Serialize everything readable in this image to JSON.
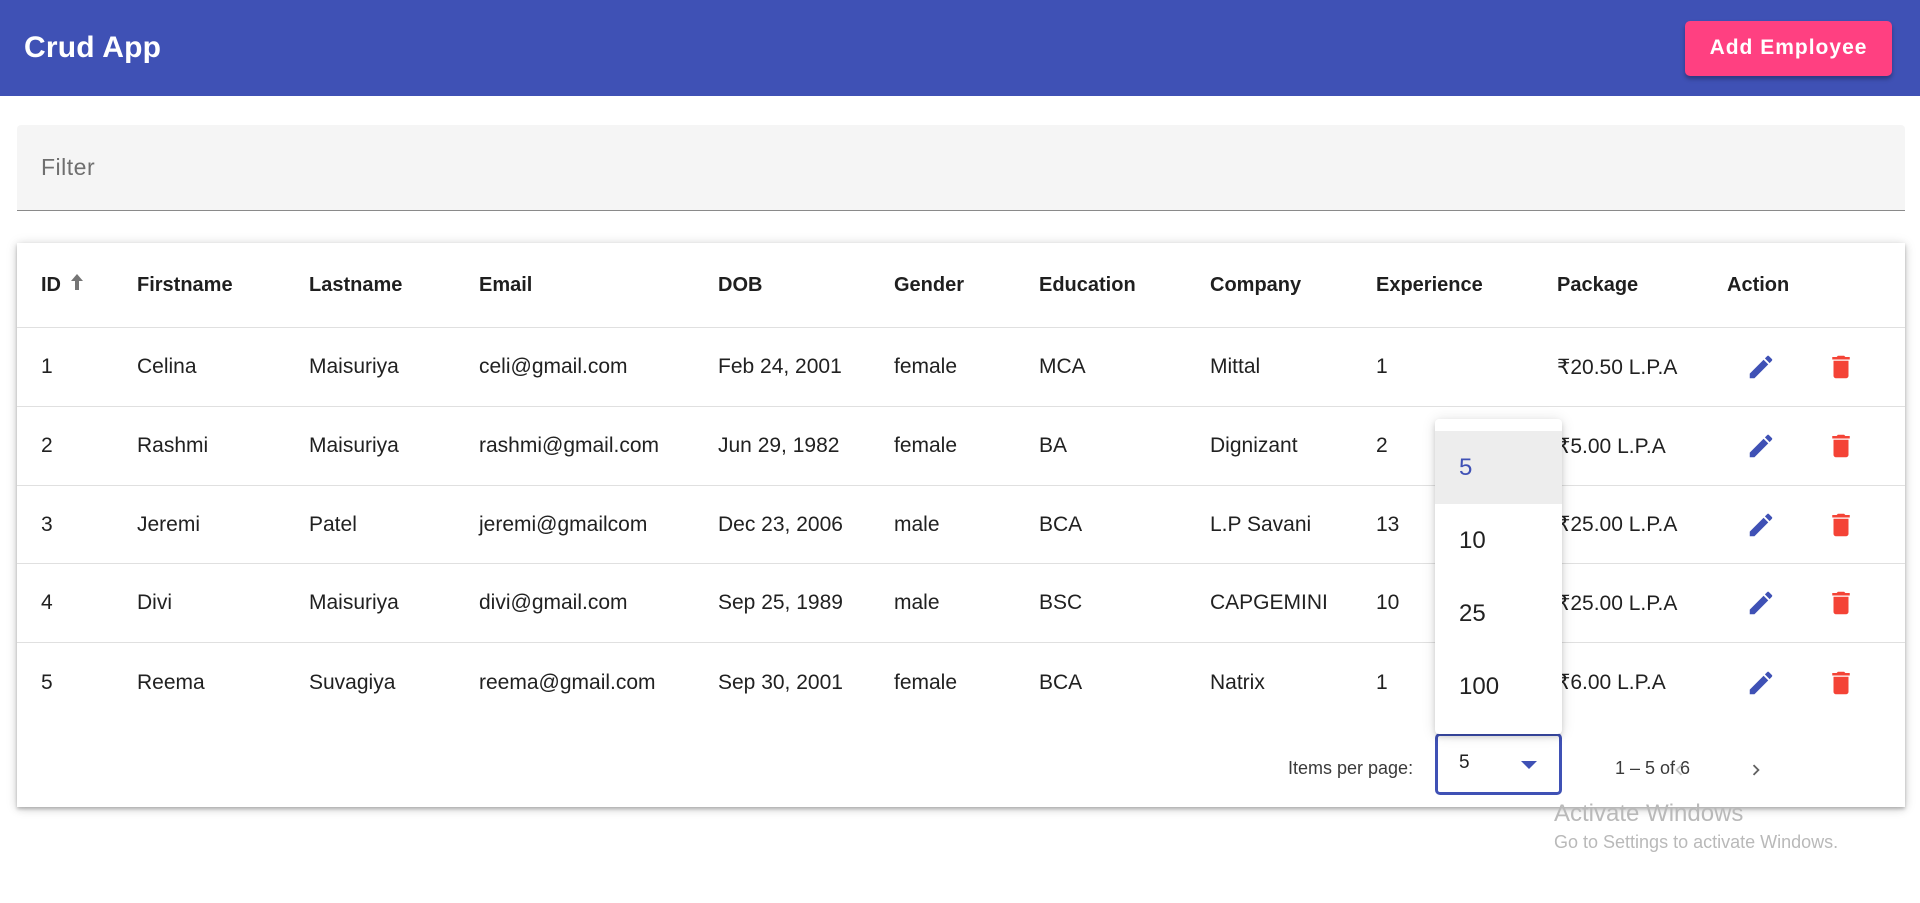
{
  "toolbar": {
    "title": "Crud App",
    "add_label": "Add Employee"
  },
  "filter": {
    "placeholder": "Filter",
    "value": ""
  },
  "table": {
    "headers": [
      "ID",
      "Firstname",
      "Lastname",
      "Email",
      "DOB",
      "Gender",
      "Education",
      "Company",
      "Experience",
      "Package",
      "Action"
    ],
    "sort_icon": "arrow-up-icon",
    "rows": [
      [
        "1",
        "Celina",
        "Maisuriya",
        "celi@gmail.com",
        "Feb 24, 2001",
        "female",
        "MCA",
        "Mittal",
        "1",
        "₹20.50 L.P.A"
      ],
      [
        "2",
        "Rashmi",
        "Maisuriya",
        "rashmi@gmail.com",
        "Jun 29, 1982",
        "female",
        "BA",
        "Dignizant",
        "2",
        "₹5.00 L.P.A"
      ],
      [
        "3",
        "Jeremi",
        "Patel",
        "jeremi@gmailcom",
        "Dec 23, 2006",
        "male",
        "BCA",
        "L.P Savani",
        "13",
        "₹25.00 L.P.A"
      ],
      [
        "4",
        "Divi",
        "Maisuriya",
        "divi@gmail.com",
        "Sep 25, 1989",
        "male",
        "BSC",
        "CAPGEMINI",
        "10",
        "₹25.00 L.P.A"
      ],
      [
        "5",
        "Reema",
        "Suvagiya",
        "reema@gmail.com",
        "Sep 30, 2001",
        "female",
        "BCA",
        "Natrix",
        "1",
        "₹6.00 L.P.A"
      ]
    ],
    "edit_icon": "edit-icon",
    "delete_icon": "delete-icon"
  },
  "paginator": {
    "items_per_page_label": "Items per page:",
    "selected_size": "5",
    "size_options": [
      "5",
      "10",
      "25",
      "100"
    ],
    "range_label": "1 – 5 of 6"
  },
  "watermark": {
    "line1": "Activate Windows",
    "line2": "Go to Settings to activate Windows."
  },
  "colors": {
    "primary": "#3f51b5",
    "accent": "#ff4081",
    "warn": "#f44336"
  }
}
